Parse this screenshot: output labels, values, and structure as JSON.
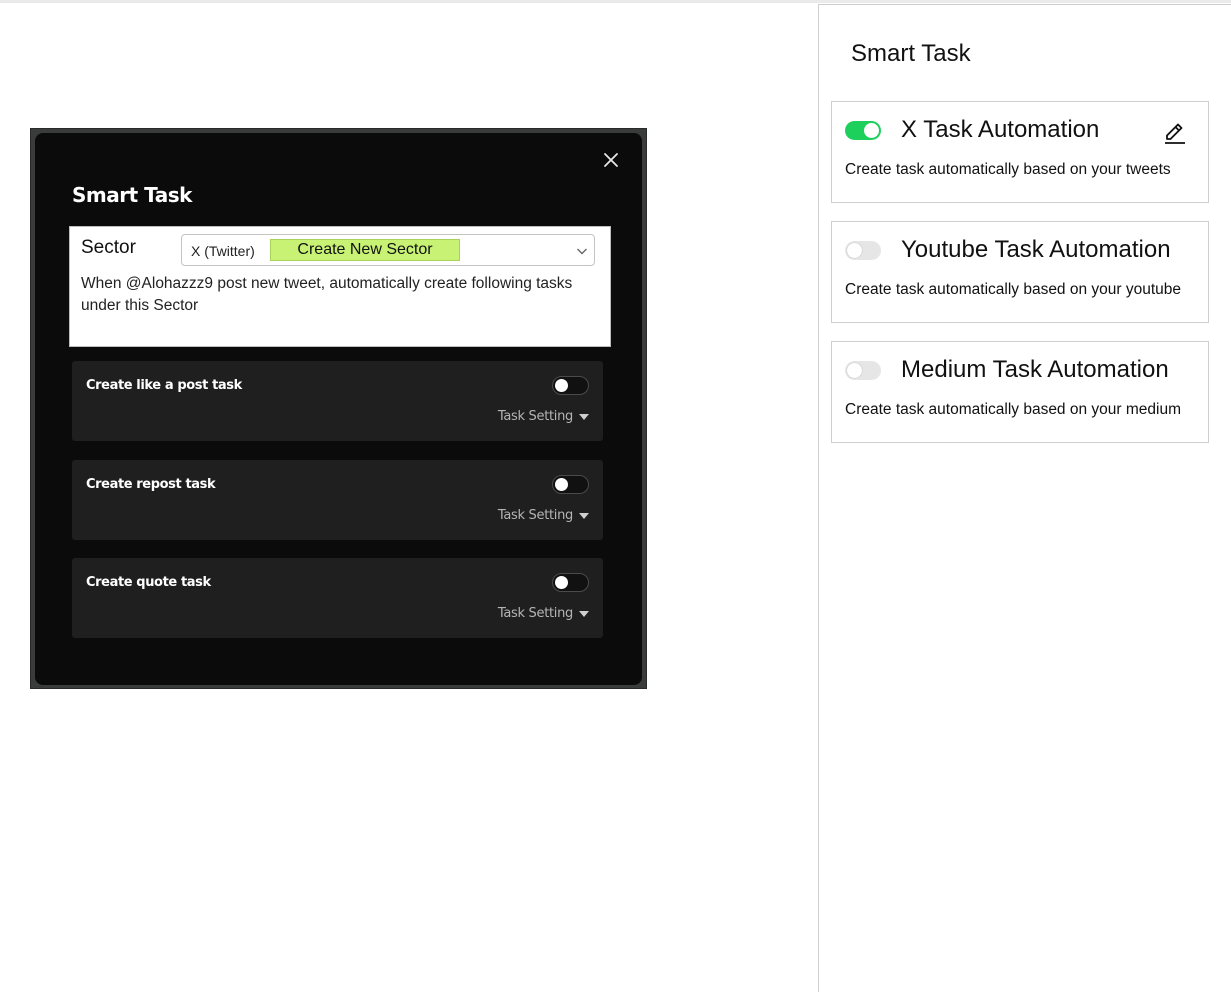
{
  "modal": {
    "title": "Smart Task",
    "sector": {
      "label": "Sector",
      "selected": "X (Twitter)",
      "create_button": "Create New Sector",
      "description": "When @Alohazzz9 post new tweet, automatically create following tasks under this Sector"
    },
    "tasks": [
      {
        "title": "Create like a post task",
        "setting_label": "Task Setting",
        "enabled": false
      },
      {
        "title": "Create repost task",
        "setting_label": "Task Setting",
        "enabled": false
      },
      {
        "title": "Create quote task",
        "setting_label": "Task Setting",
        "enabled": false
      }
    ]
  },
  "panel": {
    "title": "Smart Task",
    "automations": [
      {
        "title": "X Task Automation",
        "description": "Create task automatically based on your tweets",
        "enabled": true
      },
      {
        "title": "Youtube Task Automation",
        "description": "Create task automatically based on your youtube",
        "enabled": false
      },
      {
        "title": "Medium Task Automation",
        "description": "Create task automatically based on your medium",
        "enabled": false
      }
    ]
  },
  "colors": {
    "accent_green": "#1dd05b",
    "create_sector_bg": "#c8f274",
    "modal_bg": "#0b0b0b",
    "task_card_bg": "#1f1f1f"
  },
  "icons": {
    "close": "close-icon",
    "dropdown": "chevron-down-icon",
    "edit": "pencil-icon",
    "setting_caret": "caret-down-icon"
  }
}
